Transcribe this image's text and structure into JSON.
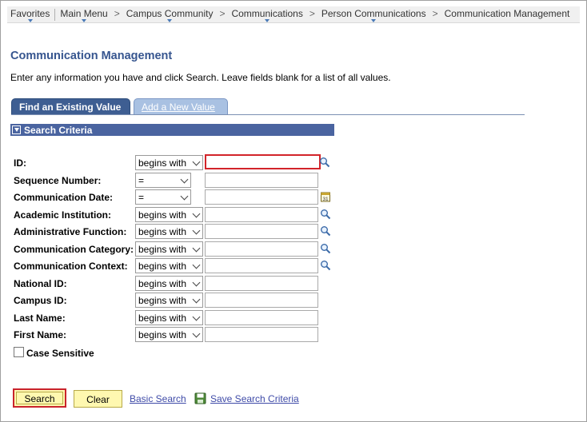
{
  "breadcrumbs": [
    {
      "label": "Favorites",
      "dropdown": true
    },
    {
      "label": "Main Menu",
      "dropdown": true
    },
    {
      "label": "Campus Community",
      "dropdown": true
    },
    {
      "label": "Communications",
      "dropdown": true
    },
    {
      "label": "Person Communications",
      "dropdown": true
    },
    {
      "label": "Communication Management",
      "dropdown": false
    }
  ],
  "breadcrumb_separator": ">",
  "page": {
    "title": "Communication Management",
    "instructions": "Enter any information you have and click Search. Leave fields blank for a list of all values."
  },
  "tabs": {
    "find": "Find an Existing Value",
    "add": "Add a New Value"
  },
  "section": {
    "title": "Search Criteria"
  },
  "fields": [
    {
      "label": "ID:",
      "operator": "begins with",
      "value": "",
      "lookup": true,
      "focused": true
    },
    {
      "label": "Sequence Number:",
      "operator": "=",
      "value": "",
      "lookup": false
    },
    {
      "label": "Communication Date:",
      "operator": "=",
      "value": "",
      "calendar": true
    },
    {
      "label": "Academic Institution:",
      "operator": "begins with",
      "value": "",
      "lookup": true
    },
    {
      "label": "Administrative Function:",
      "operator": "begins with",
      "value": "",
      "lookup": true
    },
    {
      "label": "Communication Category:",
      "operator": "begins with",
      "value": "",
      "lookup": true
    },
    {
      "label": "Communication Context:",
      "operator": "begins with",
      "value": "",
      "lookup": true
    },
    {
      "label": "National ID:",
      "operator": "begins with",
      "value": "",
      "lookup": false
    },
    {
      "label": "Campus ID:",
      "operator": "begins with",
      "value": "",
      "lookup": false
    },
    {
      "label": "Last Name:",
      "operator": "begins with",
      "value": "",
      "lookup": false
    },
    {
      "label": "First Name:",
      "operator": "begins with",
      "value": "",
      "lookup": false
    }
  ],
  "case_sensitive": {
    "label": "Case Sensitive",
    "checked": false
  },
  "buttons": {
    "search": "Search",
    "clear": "Clear",
    "basic_search": "Basic Search",
    "save_search": "Save Search Criteria"
  },
  "colors": {
    "title": "#36558f",
    "tab_active": "#3e5e92",
    "tab_inactive": "#a9c1e2",
    "section_header": "#4a64a0",
    "focus_border": "#d2242a",
    "button_fill": "#fff8b0",
    "link": "#3f4ba8"
  }
}
